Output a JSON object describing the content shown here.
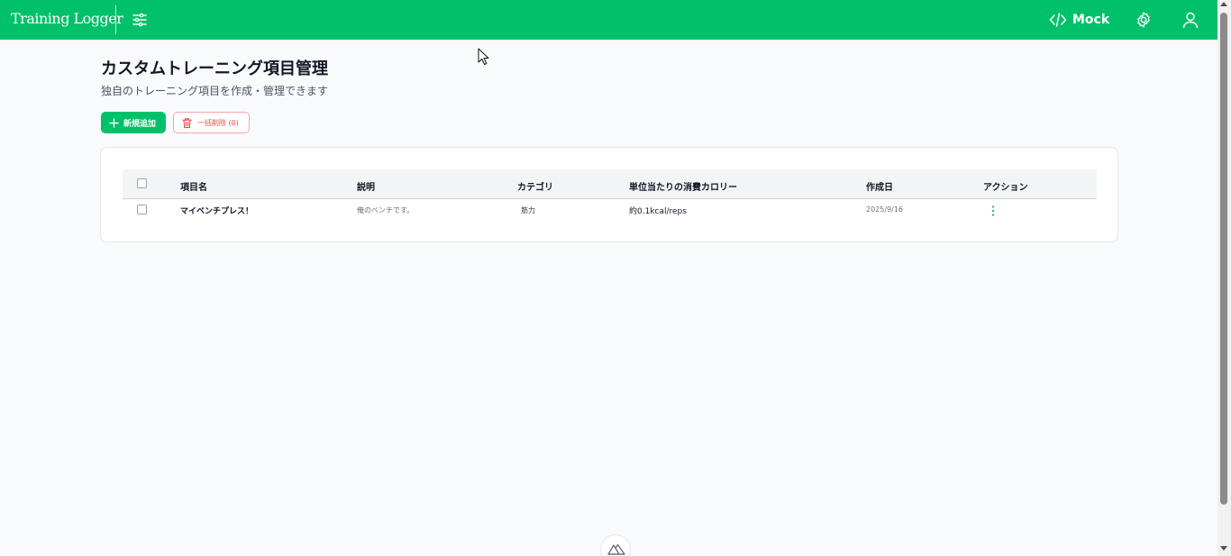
{
  "app": {
    "brand": "Training Logger",
    "mock_label": "Mock"
  },
  "page": {
    "title": "カスタムトレーニング項目管理",
    "subtitle": "独自のトレーニング項目を作成・管理できます"
  },
  "toolbar": {
    "add_label": "新規追加",
    "bulk_delete_label": "一括削除 (0)"
  },
  "table": {
    "headers": {
      "name": "項目名",
      "description": "説明",
      "category": "カテゴリ",
      "calories": "単位当たりの消費カロリー",
      "created": "作成日",
      "actions": "アクション"
    },
    "rows": [
      {
        "name": "マイベンチプレス！",
        "description": "俺のベンチです。",
        "category": "筋力",
        "calories": "約0.1kcal/reps",
        "created": "2025/9/16"
      }
    ]
  },
  "colors": {
    "brand_green": "#00c16a",
    "danger_red": "#ef4444"
  },
  "icons": {
    "filter": "sliders-icon",
    "mock": "code-icon",
    "settings": "gear-icon",
    "user": "user-icon",
    "add": "plus-icon",
    "delete": "trash-icon",
    "row_action": "more-vertical-icon",
    "footer": "nuxt-logo-icon"
  }
}
